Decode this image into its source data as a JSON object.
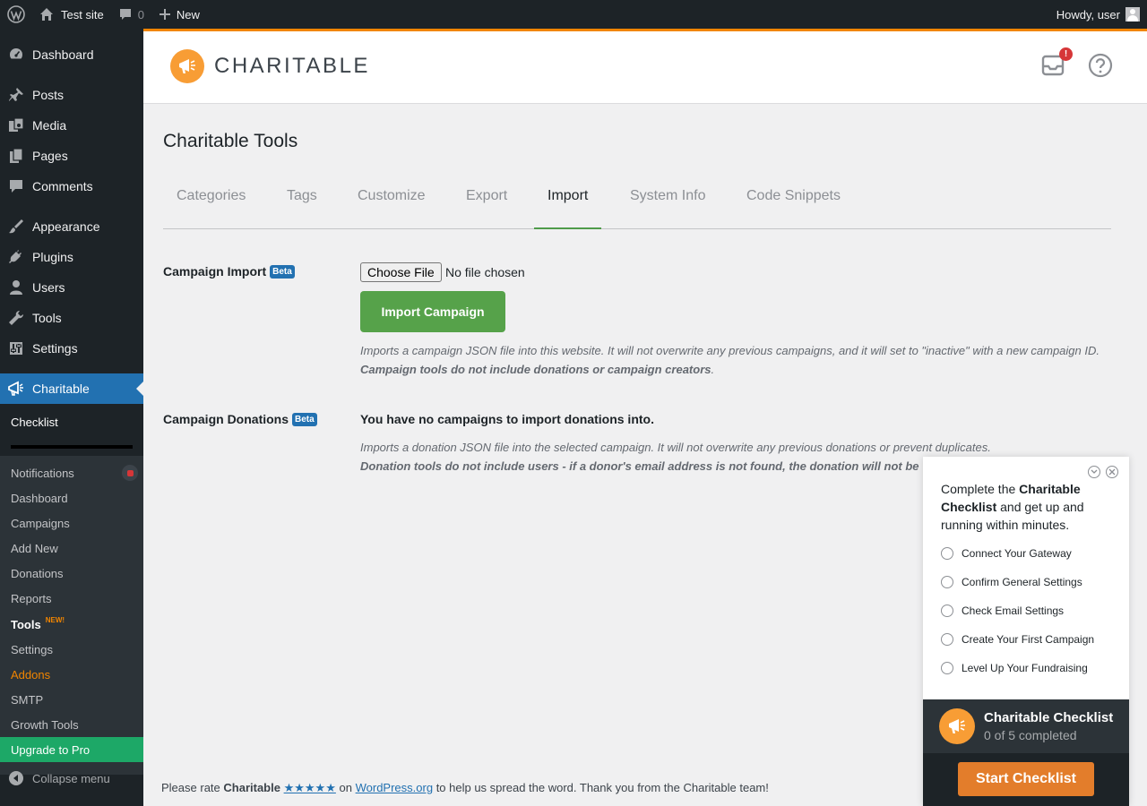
{
  "admin_bar": {
    "site_name": "Test site",
    "comments_count": "0",
    "new_label": "New",
    "howdy": "Howdy, user"
  },
  "sidebar": {
    "items": [
      {
        "label": "Dashboard",
        "icon": "dashboard-icon"
      },
      {
        "label": "Posts",
        "icon": "pin-icon"
      },
      {
        "label": "Media",
        "icon": "media-icon"
      },
      {
        "label": "Pages",
        "icon": "pages-icon"
      },
      {
        "label": "Comments",
        "icon": "comment-icon"
      },
      {
        "label": "Appearance",
        "icon": "brush-icon"
      },
      {
        "label": "Plugins",
        "icon": "plug-icon"
      },
      {
        "label": "Users",
        "icon": "user-icon"
      },
      {
        "label": "Tools",
        "icon": "wrench-icon"
      },
      {
        "label": "Settings",
        "icon": "settings-icon"
      },
      {
        "label": "Charitable",
        "icon": "megaphone-icon"
      }
    ],
    "submenu": {
      "checklist": "Checklist",
      "notifications": "Notifications",
      "dashboard": "Dashboard",
      "campaigns": "Campaigns",
      "add_new": "Add New",
      "donations": "Donations",
      "reports": "Reports",
      "tools": "Tools",
      "tools_badge": "NEW!",
      "settings": "Settings",
      "addons": "Addons",
      "smtp": "SMTP",
      "growth_tools": "Growth Tools",
      "upgrade": "Upgrade to Pro"
    },
    "collapse": "Collapse menu"
  },
  "header": {
    "logo_text": "CHARITABLE",
    "inbox_badge": "!"
  },
  "main": {
    "title": "Charitable Tools",
    "tabs": [
      {
        "label": "Categories"
      },
      {
        "label": "Tags"
      },
      {
        "label": "Customize"
      },
      {
        "label": "Export"
      },
      {
        "label": "Import"
      },
      {
        "label": "System Info"
      },
      {
        "label": "Code Snippets"
      }
    ],
    "active_tab": "Import",
    "campaign_import": {
      "label": "Campaign Import",
      "badge": "Beta",
      "choose_file": "Choose File",
      "file_status": "No file chosen",
      "button": "Import Campaign",
      "desc1": "Imports a campaign JSON file into this website. It will not overwrite any previous campaigns, and it will set to \"inactive\" with a new campaign ID.",
      "desc2": "Campaign tools do not include donations or campaign creators"
    },
    "campaign_donations": {
      "label": "Campaign Donations",
      "badge": "Beta",
      "message": "You have no campaigns to import donations into.",
      "desc1": "Imports a donation JSON file into the selected campaign. It will not overwrite any previous donations or prevent duplicates.",
      "desc2": "Donation tools do not include users - if a donor's email address is not found, the donation will not be"
    }
  },
  "footer": {
    "prefix": "Please rate",
    "brand": "Charitable",
    "stars": "★★★★★",
    "on": "on",
    "link": "WordPress.org",
    "suffix": "to help us spread the word. Thank you from the Charitable team!"
  },
  "checklist_widget": {
    "intro_prefix": "Complete the",
    "intro_bold": "Charitable Checklist",
    "intro_suffix": "and get up and running within minutes.",
    "steps": [
      "Connect Your Gateway",
      "Confirm General Settings",
      "Check Email Settings",
      "Create Your First Campaign",
      "Level Up Your Fundraising"
    ],
    "title": "Charitable Checklist",
    "progress": "0 of 5 completed",
    "completed": 0,
    "total": 5,
    "start_button": "Start Checklist"
  },
  "colors": {
    "accent": "#f18500",
    "wp_blue": "#2271b1",
    "import_green": "#56a24a",
    "start_orange": "#e37d2b"
  }
}
